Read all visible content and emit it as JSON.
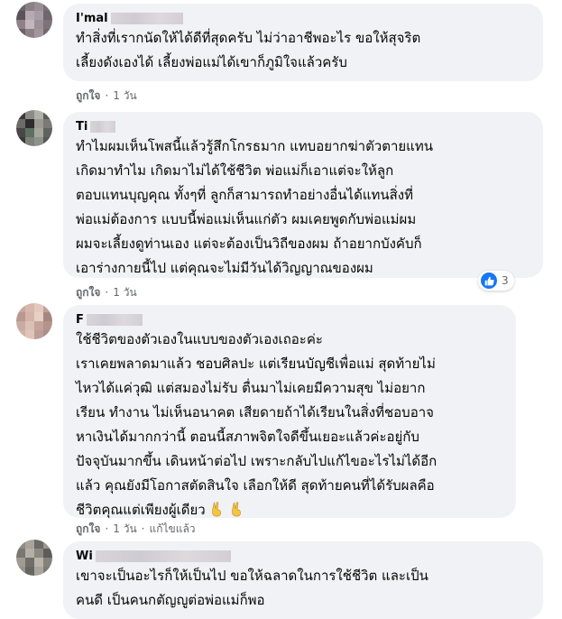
{
  "comments": [
    {
      "name": "I'mal",
      "text": "ทำสิ่งที่เรากนัดให้ได้ดีที่สุดครับ ไม่ว่าอาชีพอะไร ขอให้สุจริต\nเลี้ยงดังเองได้ เลี้ยงพ่อแม่ได้เขาก็ภูมิใจแล้วครับ",
      "like_label": "ถูกใจ",
      "time": "1 วัน"
    },
    {
      "name": "Ti",
      "text": "ทำไมผมเห็นโพสนี้แล้วรู้สึกโกรธมาก แทบอยากฆ่าตัวตายแทน\nเกิดมาทำไม เกิดมาไม่ได้ใช้ชีวิต พ่อแม่ก็เอาแต่จะให้ลูก\nตอบแทนบุญคุณ ทั้งๆที่ ลูกก็สามารถทำอย่างอื่นได้แทนสิ่งที่\nพ่อแม่ต้องการ แบบนี้พ่อแม่เห็นแก่ตัว ผมเคยพูดกับพ่อแม่ผม\nผมจะเลี้ยงดูท่านเอง แต่จะต้องเป็นวิถีของผม ถ้าอยากบังคับก็\nเอาร่างกายนี้ไป แต่คุณจะไม่มีวันได้วิญญาณของผม",
      "like_label": "ถูกใจ",
      "time": "1 วัน",
      "reaction_count": "3"
    },
    {
      "name": "F",
      "text": "ใช้ชีวิตของตัวเองในแบบของตัวเองเถอะค่ะ\nเราเคยพลาดมาแล้ว ชอบศิลปะ แต่เรียนบัญชีเพื่อแม่ สุดท้ายไม่\nไหวได้แค่วุฒิ แต่สมองไม่รับ ตื่นมาไม่เคยมีความสุข ไม่อยาก\nเรียน ทำงาน ไม่เห็นอนาคต เสียดายถ้าได้เรียนในสิ่งที่ชอบอาจ\nหาเงินได้มากกว่านี้ ตอนนี้สภาพจิตใจดีขึ้นเยอะแล้วค่ะอยู่กับ\nปัจจุบันมากขึ้น เดินหน้าต่อไป เพราะกลับไปแก้ไขอะไรไม่ได้อีก\nแล้ว คุณยังมีโอกาสตัดสินใจ เลือกให้ดี สุดท้ายคนที่ได้รับผลคือ\nชีวิตคุณแต่เพียงผู้เดียว",
      "like_label": "ถูกใจ",
      "time": "1 วัน",
      "edited_label": "แก้ไขแล้ว"
    },
    {
      "name": "Wi",
      "text": "เขาจะเป็นอะไรก็ให้เป็นไป ขอให้ฉลาดในการใช้ชีวิต และเป็น\nคนดี เป็นคนกตัญญูต่อพ่อแม่ก็พอ"
    }
  ],
  "colors": {
    "bubble_bg": "#f0f2f5",
    "secondary_text": "#65676b",
    "like_blue": "#1877f2"
  },
  "icons": {
    "reaction": "like-icon",
    "emoji": "victory-hand-icon"
  }
}
